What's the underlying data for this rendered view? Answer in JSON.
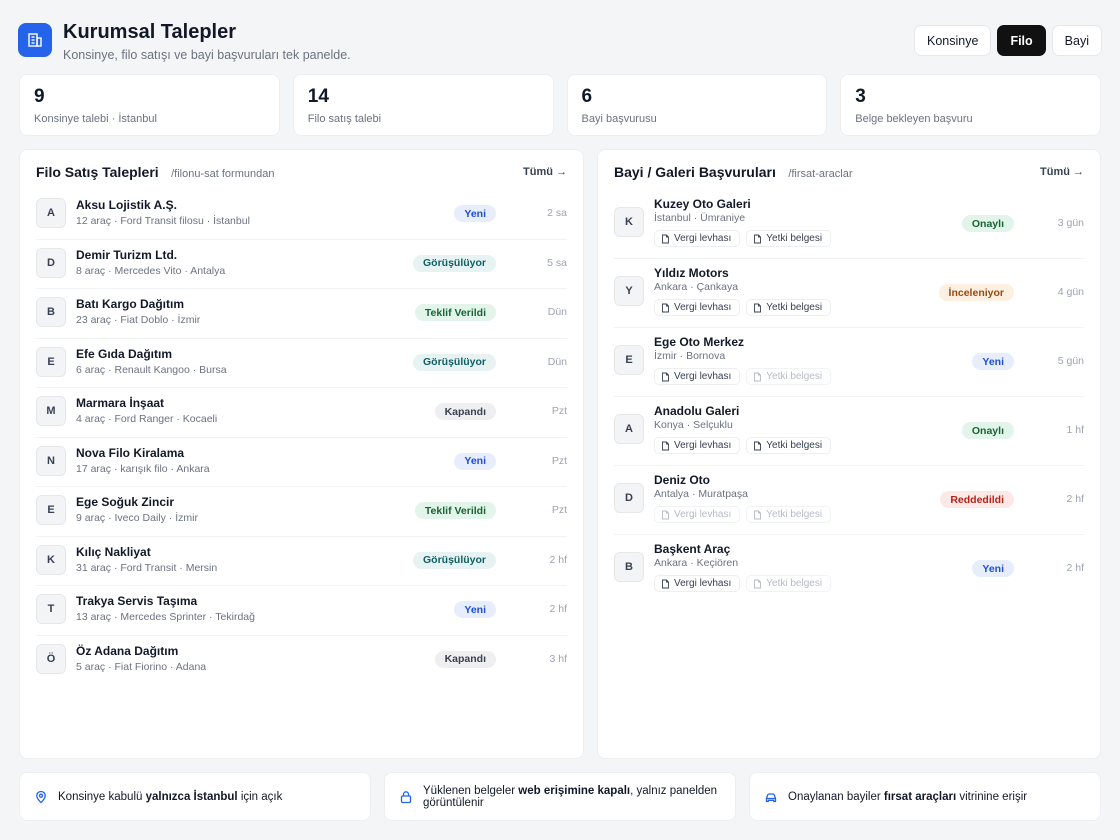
{
  "header": {
    "title": "Kurumsal Talepler",
    "subtitle": "Konsinye, filo satışı ve bayi başvuruları tek panelde.",
    "tabs": [
      {
        "label": "Konsinye",
        "active": false
      },
      {
        "label": "Filo",
        "active": true
      },
      {
        "label": "Bayi",
        "active": false
      }
    ]
  },
  "stats": [
    {
      "value": "9",
      "label": "Konsinye talebi · İstanbul"
    },
    {
      "value": "14",
      "label": "Filo satış talebi"
    },
    {
      "value": "6",
      "label": "Bayi başvurusu"
    },
    {
      "value": "3",
      "label": "Belge bekleyen başvuru"
    }
  ],
  "fleet": {
    "title": "Filo Satış Talepleri",
    "path": "/filonu-sat formundan",
    "all_link": "Tümü →",
    "rows": [
      {
        "initial": "A",
        "name": "Aksu Lojistik A.Ş.",
        "meta": "12 araç · Ford Transit filosu · İstanbul",
        "status": "Yeni",
        "tone": "b-new",
        "time": "2 sa"
      },
      {
        "initial": "D",
        "name": "Demir Turizm Ltd.",
        "meta": "8 araç · Mercedes Vito · Antalya",
        "status": "Görüşülüyor",
        "tone": "b-talk",
        "time": "5 sa"
      },
      {
        "initial": "B",
        "name": "Batı Kargo Dağıtım",
        "meta": "23 araç · Fiat Doblo · İzmir",
        "status": "Teklif Verildi",
        "tone": "b-offer",
        "time": "Dün"
      },
      {
        "initial": "E",
        "name": "Efe Gıda Dağıtım",
        "meta": "6 araç · Renault Kangoo · Bursa",
        "status": "Görüşülüyor",
        "tone": "b-talk",
        "time": "Dün"
      },
      {
        "initial": "M",
        "name": "Marmara İnşaat",
        "meta": "4 araç · Ford Ranger · Kocaeli",
        "status": "Kapandı",
        "tone": "b-closed",
        "time": "Pzt"
      },
      {
        "initial": "N",
        "name": "Nova Filo Kiralama",
        "meta": "17 araç · karışık filo · Ankara",
        "status": "Yeni",
        "tone": "b-new",
        "time": "Pzt"
      },
      {
        "initial": "E",
        "name": "Ege Soğuk Zincir",
        "meta": "9 araç · Iveco Daily · İzmir",
        "status": "Teklif Verildi",
        "tone": "b-offer",
        "time": "Pzt"
      },
      {
        "initial": "K",
        "name": "Kılıç Nakliyat",
        "meta": "31 araç · Ford Transit · Mersin",
        "status": "Görüşülüyor",
        "tone": "b-talk",
        "time": "2 hf"
      },
      {
        "initial": "T",
        "name": "Trakya Servis Taşıma",
        "meta": "13 araç · Mercedes Sprinter · Tekirdağ",
        "status": "Yeni",
        "tone": "b-new",
        "time": "2 hf"
      },
      {
        "initial": "Ö",
        "name": "Öz Adana Dağıtım",
        "meta": "5 araç · Fiat Fiorino · Adana",
        "status": "Kapandı",
        "tone": "b-closed",
        "time": "3 hf"
      }
    ]
  },
  "dealers": {
    "title": "Bayi / Galeri Başvuruları",
    "path": "/firsat-araclar",
    "all_link": "Tümü →",
    "doc_tax": "Vergi levhası",
    "doc_auth": "Yetki belgesi",
    "rows": [
      {
        "initial": "K",
        "name": "Kuzey Oto Galeri",
        "meta": "İstanbul · Ümraniye",
        "status": "Onaylı",
        "tone": "b-ok",
        "time": "3 gün",
        "tax": true,
        "auth": true
      },
      {
        "initial": "Y",
        "name": "Yıldız Motors",
        "meta": "Ankara · Çankaya",
        "status": "İnceleniyor",
        "tone": "b-review",
        "time": "4 gün",
        "tax": true,
        "auth": true
      },
      {
        "initial": "E",
        "name": "Ege Oto Merkez",
        "meta": "İzmir · Bornova",
        "status": "Yeni",
        "tone": "b-new",
        "time": "5 gün",
        "tax": true,
        "auth": false
      },
      {
        "initial": "A",
        "name": "Anadolu Galeri",
        "meta": "Konya · Selçuklu",
        "status": "Onaylı",
        "tone": "b-ok",
        "time": "1 hf",
        "tax": true,
        "auth": true
      },
      {
        "initial": "D",
        "name": "Deniz Oto",
        "meta": "Antalya · Muratpaşa",
        "status": "Reddedildi",
        "tone": "b-rej",
        "time": "2 hf",
        "tax": false,
        "auth": false
      },
      {
        "initial": "B",
        "name": "Başkent Araç",
        "meta": "Ankara · Keçiören",
        "status": "Yeni",
        "tone": "b-new",
        "time": "2 hf",
        "tax": true,
        "auth": false
      }
    ]
  },
  "footer": [
    {
      "icon": "map-pin-icon",
      "before": "Konsinye kabulü ",
      "bold": "yalnızca İstanbul",
      "after": " için açık"
    },
    {
      "icon": "lock-icon",
      "before": "Yüklenen belgeler ",
      "bold": "web erişimine kapalı",
      "after": ", yalnız panelden görüntülenir"
    },
    {
      "icon": "car-icon",
      "before": "Onaylanan bayiler ",
      "bold": "fırsat araçları",
      "after": " vitrinine erişir"
    }
  ]
}
